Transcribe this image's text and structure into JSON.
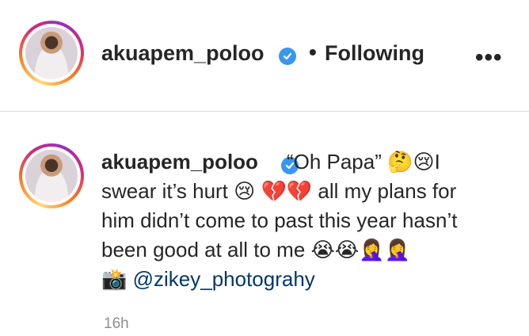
{
  "header": {
    "username": "akuapem_poloo",
    "separator": "•",
    "follow_status": "Following",
    "more": "•••"
  },
  "post": {
    "username": "akuapem_poloo",
    "caption_lines": [
      "“Oh Papa” 🤔😢I",
      "swear it’s hurt 😢 💔💔 all my plans for",
      "him didn’t come to past this year hasn’t",
      "been good at all to me 😭😭🤦‍♀️🤦‍♀️"
    ],
    "camera_emoji": "📸",
    "mention": "@zikey_photograhy",
    "timestamp": "16h"
  },
  "colors": {
    "verified": "#3897f0",
    "mention": "#00376b",
    "muted": "#8e8e8e",
    "divider": "#dbdbdb"
  },
  "icons": [
    "verified-badge-icon",
    "more-options-icon",
    "avatar-story-ring"
  ]
}
